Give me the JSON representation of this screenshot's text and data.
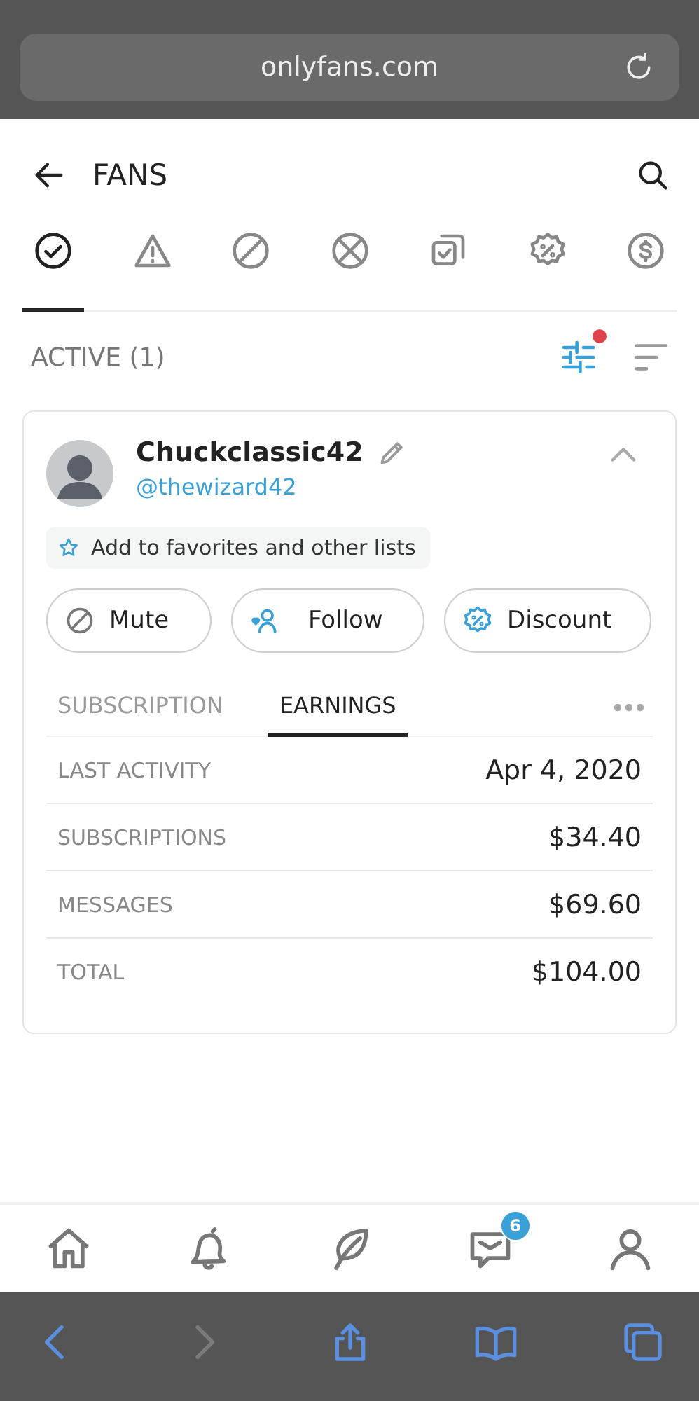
{
  "browser": {
    "url": "onlyfans.com"
  },
  "header": {
    "title": "FANS"
  },
  "filter_tabs": [
    {
      "kind": "check",
      "selected": true
    },
    {
      "kind": "warning",
      "selected": false
    },
    {
      "kind": "blocked",
      "selected": false
    },
    {
      "kind": "cancel",
      "selected": false
    },
    {
      "kind": "copy",
      "selected": false
    },
    {
      "kind": "discount",
      "selected": false
    },
    {
      "kind": "dollar",
      "selected": false
    }
  ],
  "section": {
    "label": "ACTIVE (1)",
    "filter_notice": true
  },
  "card": {
    "name": "Chuckclassic42",
    "handle": "@thewizard42",
    "favorites": "Add to favorites and other lists",
    "actions": [
      {
        "kind": "mute",
        "label": "Mute"
      },
      {
        "kind": "follow",
        "label": "Follow"
      },
      {
        "kind": "discount",
        "label": "Discount"
      }
    ],
    "tabs": [
      {
        "label": "SUBSCRIPTION",
        "selected": false
      },
      {
        "label": "EARNINGS",
        "selected": true
      }
    ],
    "rows": [
      {
        "label": "LAST ACTIVITY",
        "value": "Apr 4, 2020"
      },
      {
        "label": "SUBSCRIPTIONS",
        "value": "$34.40"
      },
      {
        "label": "MESSAGES",
        "value": "$69.60"
      },
      {
        "label": "TOTAL",
        "value": "$104.00"
      }
    ]
  },
  "bottom_nav": [
    {
      "kind": "home"
    },
    {
      "kind": "bell"
    },
    {
      "kind": "leaf"
    },
    {
      "kind": "messages",
      "badge": "6"
    },
    {
      "kind": "profile"
    }
  ],
  "browser_toolbar": [
    {
      "kind": "back",
      "disabled": false
    },
    {
      "kind": "forward",
      "disabled": true
    },
    {
      "kind": "share",
      "disabled": false
    },
    {
      "kind": "bookmarks",
      "disabled": false
    },
    {
      "kind": "tabs",
      "disabled": false
    }
  ]
}
